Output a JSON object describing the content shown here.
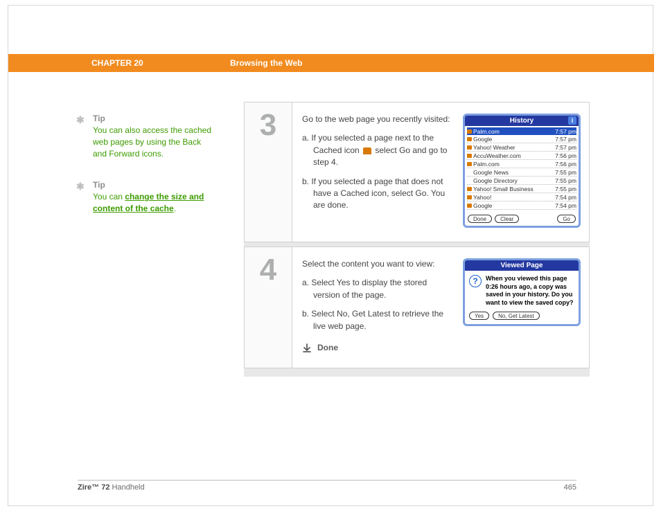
{
  "header": {
    "chapter": "CHAPTER 20",
    "title": "Browsing the Web"
  },
  "tips": [
    {
      "label": "Tip",
      "body": "You can also access the cached web pages by using the Back and Forward icons."
    },
    {
      "label": "Tip",
      "body_prefix": "You can ",
      "link": "change the size and content of the cache",
      "body_suffix": "."
    }
  ],
  "steps": {
    "s3": {
      "num": "3",
      "intro": "Go to the web page you recently visited:",
      "a_pre": "a.  If you selected a page next to the Cached icon ",
      "a_post": " select Go and go to step 4.",
      "b": "b.  If you selected a page that does not have a Cached icon, select Go. You are done."
    },
    "s4": {
      "num": "4",
      "intro": "Select the content you want to view:",
      "a": "a.  Select Yes to display the stored version of the page.",
      "b": "b.  Select No, Get Latest to retrieve the live web page.",
      "done": "Done"
    }
  },
  "history": {
    "title": "History",
    "rows": [
      {
        "site": "Palm.com",
        "time": "7:57 pm",
        "cached": true
      },
      {
        "site": "Google",
        "time": "7:57 pm",
        "cached": true
      },
      {
        "site": "Yahoo! Weather",
        "time": "7:57 pm",
        "cached": true
      },
      {
        "site": "AccuWeather.com",
        "time": "7:56 pm",
        "cached": true
      },
      {
        "site": "Palm.com",
        "time": "7:56 pm",
        "cached": true
      },
      {
        "site": "Google News",
        "time": "7:55 pm",
        "cached": false
      },
      {
        "site": "Google Directory",
        "time": "7:55 pm",
        "cached": false
      },
      {
        "site": "Yahoo! Small Business",
        "time": "7:55 pm",
        "cached": true
      },
      {
        "site": "Yahoo!",
        "time": "7:54 pm",
        "cached": true
      },
      {
        "site": "Google",
        "time": "7:54 pm",
        "cached": true
      }
    ],
    "btn_done": "Done",
    "btn_clear": "Clear",
    "btn_go": "Go"
  },
  "viewed": {
    "title": "Viewed Page",
    "body": "When you viewed this page 0:26 hours ago, a copy was saved in your history. Do you want to view the saved copy?",
    "btn_yes": "Yes",
    "btn_no": "No, Get Latest"
  },
  "footer": {
    "product_bold": "Zire™ 72",
    "product_rest": " Handheld",
    "page": "465"
  }
}
